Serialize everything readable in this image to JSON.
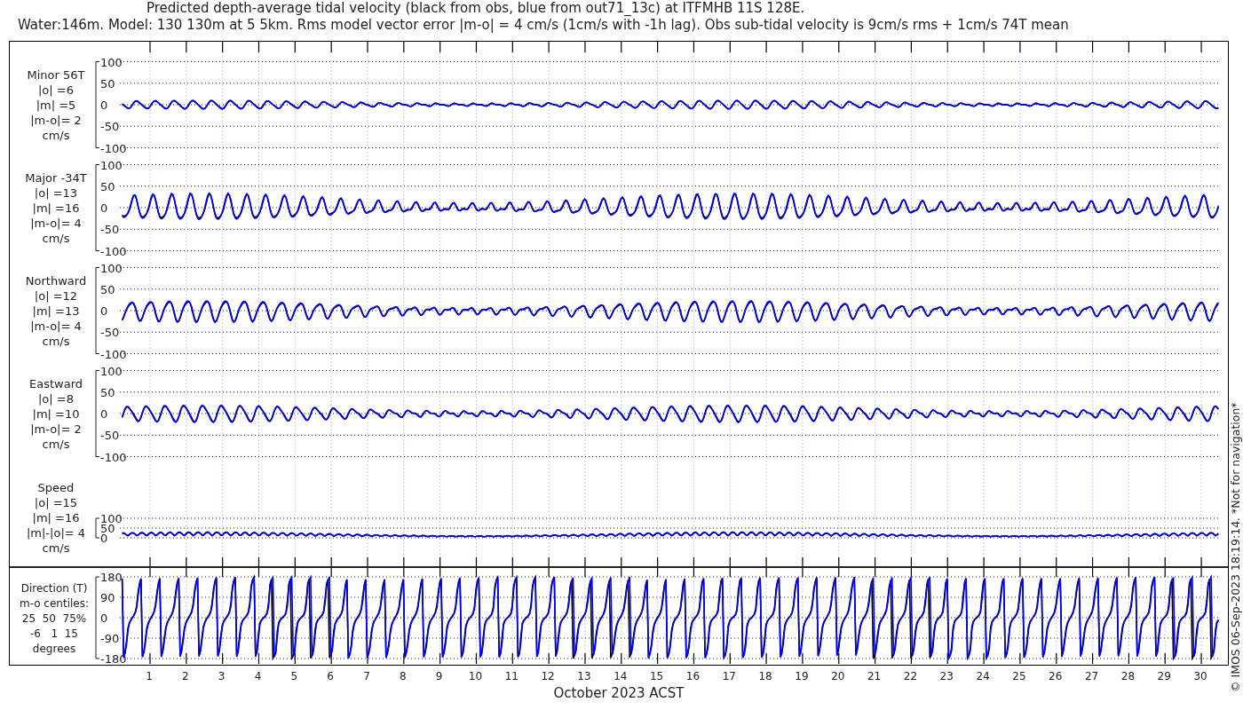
{
  "title": "Predicted depth-average tidal velocity (black from obs, blue from out71_13c) at ITFMHB 11S 128E.",
  "subtitle": "Water:146m. Model: 130 130m at 5 5km. Rms model vector error |m-o| = 4 cm/s (1cm/s with -1h lag). Obs sub-tidal velocity is 9cm/s rms + 1cm/s 74T mean",
  "panels": [
    {
      "kind": "signed",
      "label_lines": [
        "Minor 56T",
        "|o| =6",
        "|m| =5",
        "|m-o|= 2",
        "cm/s"
      ],
      "yticks": [
        "100",
        "50",
        "0",
        "-50",
        "-100"
      ]
    },
    {
      "kind": "signed",
      "label_lines": [
        "Major -34T",
        "|o| =13",
        "|m| =16",
        "|m-o|= 4",
        "cm/s"
      ],
      "yticks": [
        "100",
        "50",
        "0",
        "-50",
        "-100"
      ]
    },
    {
      "kind": "signed",
      "label_lines": [
        "Northward",
        "|o| =12",
        "|m| =13",
        "|m-o|= 4",
        "cm/s"
      ],
      "yticks": [
        "100",
        "50",
        "0",
        "-50",
        "-100"
      ]
    },
    {
      "kind": "signed",
      "label_lines": [
        "Eastward",
        "|o| =8",
        "|m| =10",
        "|m-o|= 2",
        "cm/s"
      ],
      "yticks": [
        "100",
        "50",
        "0",
        "-50",
        "-100"
      ]
    },
    {
      "kind": "speed",
      "label_lines": [
        "Speed",
        "|o| =15",
        "|m| =16",
        "|m|-|o|= 4",
        "cm/s"
      ],
      "yticks": [
        "100",
        "50",
        "0"
      ]
    }
  ],
  "direction": {
    "label_lines": [
      "Direction (T)",
      "m-o centiles:",
      "25  50  75%",
      "-6   1  15",
      "degrees"
    ],
    "yticks": [
      "180",
      "90",
      "0",
      "-90",
      "-180"
    ]
  },
  "days": [
    "1",
    "2",
    "3",
    "4",
    "5",
    "6",
    "7",
    "8",
    "9",
    "10",
    "11",
    "12",
    "13",
    "14",
    "15",
    "16",
    "17",
    "18",
    "19",
    "20",
    "21",
    "22",
    "23",
    "24",
    "25",
    "26",
    "27",
    "28",
    "29",
    "30"
  ],
  "xlabel": "October 2023 ACST",
  "credit": "© IMOS 06-Sep-2023 18:19:14. *Not for navigation*"
}
